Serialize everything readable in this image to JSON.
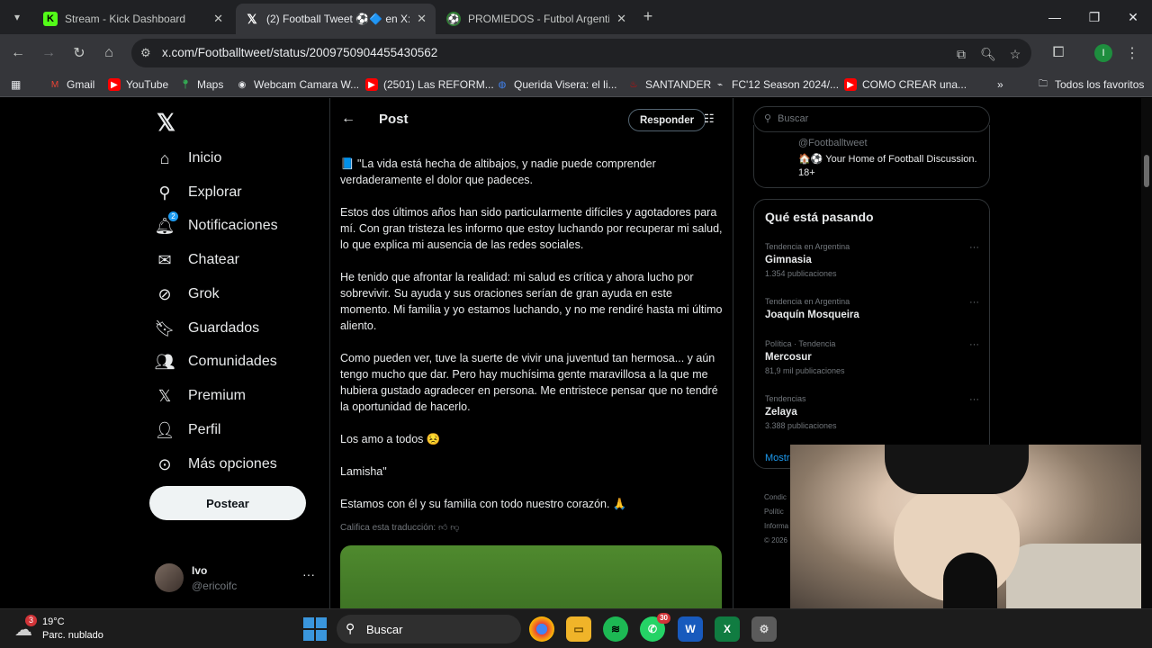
{
  "tabs": [
    {
      "title": "Stream - Kick Dashboard",
      "icon": "kick-icon"
    },
    {
      "title": "(2) Football Tweet ⚽🔷 en X: \"",
      "icon": "x-logo-icon"
    },
    {
      "title": "PROMIEDOS - Futbol Argentino",
      "icon": "promiedos-icon"
    }
  ],
  "address": {
    "url": "x.com/Footballtweet/status/2009750904455430562"
  },
  "profile_initial": "I",
  "bookmarks": {
    "items": [
      "Gmail",
      "YouTube",
      "Maps",
      "Webcam Camara W...",
      "(2501) Las REFORM...",
      "Querida Visera: el li...",
      "SANTANDER",
      "FC'12 Season 2024/...",
      "COMO CREAR una..."
    ],
    "more": "»",
    "all": "Todos los favoritos"
  },
  "leftnav": {
    "items": [
      "Inicio",
      "Explorar",
      "Notificaciones",
      "Chatear",
      "Grok",
      "Guardados",
      "Comunidades",
      "Premium",
      "Perfil",
      "Más opciones"
    ],
    "notif_badge": "2",
    "post_button": "Postear",
    "account": {
      "name": "Ivo",
      "handle": "@ericoifc"
    }
  },
  "post": {
    "header": "Post",
    "reply_button": "Responder",
    "paragraphs": [
      "📘 \"La vida está hecha de altibajos, y nadie puede comprender verdaderamente el dolor que padeces.",
      "Estos dos últimos años han sido particularmente difíciles y agotadores para mí. Con gran tristeza les informo que estoy luchando por recuperar mi salud, lo que explica mi ausencia de las redes sociales.",
      "He tenido que afrontar la realidad: mi salud es crítica y ahora lucho por sobrevivir. Su ayuda y sus oraciones serían de gran ayuda en este momento. Mi familia y yo estamos luchando, y no me rendiré hasta mi último aliento.",
      "Como pueden ver, tuve la suerte de vivir una juventud tan hermosa... y aún tengo mucho que dar. Pero hay muchísima gente maravillosa a la que me hubiera gustado agradecer en persona. Me entristece pensar que no tendré la oportunidad de hacerlo.",
      "Los amo a todos 😣",
      "Lamisha\"",
      "Estamos con él y su familia con todo nuestro corazón. 🙏"
    ],
    "translation_prompt": "Califica esta traducción:"
  },
  "right": {
    "search_placeholder": "Buscar",
    "account_handle": "@Footballtweet",
    "account_bio": "🏠⚽ Your Home of Football Discussion. 18+",
    "trends_title": "Qué está pasando",
    "trends": [
      {
        "context": "Tendencia en Argentina",
        "name": "Gimnasia",
        "posts": "1.354 publicaciones"
      },
      {
        "context": "Tendencia en Argentina",
        "name": "Joaquín Mosqueira",
        "posts": ""
      },
      {
        "context": "Política · Tendencia",
        "name": "Mercosur",
        "posts": "81,9 mil publicaciones"
      },
      {
        "context": "Tendencias",
        "name": "Zelaya",
        "posts": "3.388 publicaciones"
      }
    ],
    "show_more": "Mostr",
    "footer": [
      "Condic",
      "Polític",
      "Informa",
      "© 2026"
    ]
  },
  "taskbar": {
    "weather_badge": "3",
    "temperature": "19°C",
    "weather_desc": "Parc. nublado",
    "search": "Buscar",
    "whatsapp_badge": "30"
  }
}
